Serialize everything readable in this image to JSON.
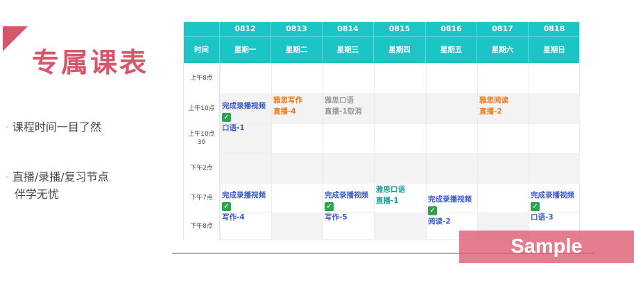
{
  "title": "专属课表",
  "bullets": [
    {
      "line1": "课程时间一目了然",
      "line2": ""
    },
    {
      "line1": "直播/录播/复习节点",
      "line2": "伴学无忧"
    }
  ],
  "schedule": {
    "time_header": "时间",
    "dates": [
      "0812",
      "0813",
      "0814",
      "0815",
      "0816",
      "0817",
      "0818"
    ],
    "weekdays": [
      "星期一",
      "星期二",
      "星期三",
      "星期四",
      "星期五",
      "星期六",
      "星期日"
    ],
    "time_slots": [
      {
        "line1": "上午8点",
        "line2": ""
      },
      {
        "line1": "上午10点",
        "line2": ""
      },
      {
        "line1": "上午10点",
        "line2": "30"
      },
      {
        "line1": "下午2点",
        "line2": ""
      },
      {
        "line1": "下午7点",
        "line2": ""
      },
      {
        "line1": "下午8点",
        "line2": ""
      }
    ],
    "entries": {
      "mon_am_1": "完成录播视频",
      "mon_am_2": "口语-1",
      "tue_am_1": "雅思写作",
      "tue_am_2": "直播-4",
      "wed_am_1": "雅思口语",
      "wed_am_2": "直播-1取消",
      "sat_am_1": "雅思阅读",
      "sat_am_2": "直播-2",
      "mon_pm_1": "完成录播视频",
      "mon_pm_2": "写作-4",
      "wed_pm_1": "完成录播视频",
      "wed_pm_2": "写作-5",
      "thu_pm_1": "雅思口语",
      "thu_pm_2": "直播-1",
      "fri_pm_1": "完成录播视频",
      "fri_pm_2": "阅读-2",
      "sun_pm_1": "完成录播视频",
      "sun_pm_2": "口语-3"
    },
    "check_symbol": "✓"
  },
  "watermark": "Sample",
  "colors": {
    "accent": "#d6576b",
    "header": "#1bc5c5",
    "blue_text": "#3b5bc9",
    "orange_text": "#f07a1b",
    "gray_text": "#9a9a9a",
    "teal_text": "#169e93",
    "check_green": "#2ea44f"
  }
}
